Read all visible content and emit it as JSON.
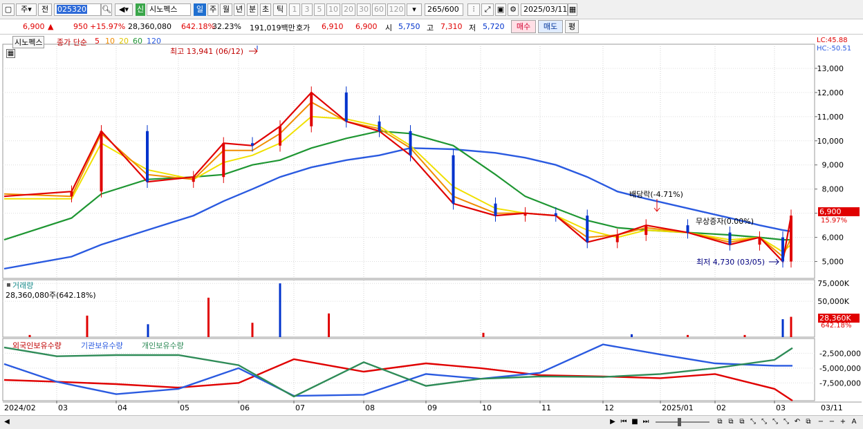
{
  "toolbar": {
    "jong_label": "주",
    "jeon_label": "전",
    "code_value": "025320",
    "name_badge": "신",
    "stock_name": "시노펙스",
    "period_tabs": [
      "일",
      "주",
      "월",
      "년",
      "분",
      "초",
      "틱"
    ],
    "interval_buttons": [
      "1",
      "3",
      "5",
      "10",
      "20",
      "30",
      "60",
      "120"
    ],
    "count_value": "265",
    "count_total": "/600",
    "date_value": "2025/03/11"
  },
  "quote": {
    "price": "6,900",
    "change": "950",
    "change_pct": "+15.97%",
    "volume": "28,360,080",
    "volume_ratio": "642.18%",
    "turnover_pct": "32.23%",
    "amount": "191,019백만",
    "hoga_label": "호가",
    "ask": "6,910",
    "bid": "6,900",
    "open_label": "시",
    "open": "5,750",
    "high_label": "고",
    "high": "7,310",
    "low_label": "저",
    "low": "5,720",
    "buy_label": "매수",
    "sell_label": "매도",
    "eval_label": "평"
  },
  "price_panel": {
    "title": "시노펙스",
    "legend_prefix": "종가 단순",
    "ma_labels": [
      "5",
      "10",
      "20",
      "60",
      "120"
    ],
    "lc_text": "LC:45.88",
    "hc_text": "HC:-50.51",
    "high_annotation": "최고 13,941 (06/12)",
    "low_annotation": "최저 4,730 (03/05)",
    "dividend_annotation": "배당락(-4.71%)",
    "bonus_annotation": "무상증자(0.00%)",
    "current_price_tag": "6,900",
    "current_pct_tag": "15.97%"
  },
  "volume_panel": {
    "title": "거래량",
    "value_text": "28,360,080주(642.18%)",
    "current_tag": "28,360K",
    "current_pct": "642.18%"
  },
  "holding_panel": {
    "series_labels": [
      "외국인보유수량",
      "기관보유수량",
      "개인보유수량"
    ]
  },
  "colors": {
    "up": "#e00000",
    "down": "#0033cc",
    "ma5": "#e00000",
    "ma10": "#f08c00",
    "ma20": "#f0e000",
    "ma60": "#1e9632",
    "ma120": "#2a5ae0",
    "foreign": "#e00000",
    "institution": "#2a5ae0",
    "individual": "#2e8b57"
  },
  "chart_data": [
    {
      "type": "line",
      "panel": "price",
      "title": "시노펙스",
      "x_ticks": [
        "2024/02",
        "03",
        "04",
        "05",
        "06",
        "07",
        "08",
        "09",
        "10",
        "11",
        "12",
        "2025/01",
        "02",
        "03",
        "03/11"
      ],
      "y_ticks": [
        5000,
        6000,
        7000,
        8000,
        9000,
        10000,
        11000,
        12000,
        13000
      ],
      "ylim": [
        4300,
        14000
      ],
      "x": [
        "2024-02",
        "2024-03",
        "2024-03",
        "2024-04",
        "2024-05",
        "2024-05",
        "2024-06",
        "2024-06",
        "2024-07",
        "2024-07",
        "2024-08",
        "2024-08",
        "2024-09",
        "2024-10",
        "2024-10",
        "2024-11",
        "2024-11",
        "2024-12",
        "2024-12",
        "2025-01",
        "2025-02",
        "2025-02",
        "2025-03",
        "2025-03-11"
      ],
      "series": [
        {
          "name": "5",
          "values": [
            7700,
            7900,
            10400,
            8300,
            8500,
            9900,
            9800,
            10600,
            12000,
            10800,
            10400,
            9400,
            7400,
            6900,
            7000,
            6900,
            5800,
            6100,
            6500,
            6200,
            5700,
            6000,
            5000,
            6900
          ]
        },
        {
          "name": "10",
          "values": [
            7800,
            7700,
            10300,
            8600,
            8400,
            9600,
            9600,
            10300,
            11600,
            10800,
            10500,
            9700,
            7700,
            7000,
            7000,
            6900,
            6000,
            6100,
            6400,
            6200,
            5800,
            6000,
            5200,
            6000
          ]
        },
        {
          "name": "20",
          "values": [
            7600,
            7600,
            9900,
            8800,
            8400,
            9100,
            9400,
            9900,
            11000,
            10900,
            10600,
            9800,
            8100,
            7200,
            7000,
            6900,
            6300,
            6000,
            6300,
            6200,
            5900,
            6000,
            5400,
            5700
          ]
        },
        {
          "name": "60",
          "values": [
            5900,
            6800,
            7800,
            8400,
            8500,
            8600,
            9000,
            9200,
            9700,
            10100,
            10400,
            10300,
            9800,
            8600,
            7700,
            7200,
            6700,
            6400,
            6300,
            6200,
            6100,
            6000,
            5900,
            5900
          ]
        },
        {
          "name": "120",
          "values": [
            4700,
            5200,
            5700,
            6300,
            6900,
            7500,
            8000,
            8500,
            8900,
            9200,
            9400,
            9700,
            9650,
            9500,
            9300,
            9000,
            8500,
            7900,
            7600,
            7200,
            6800,
            6500,
            6300,
            6250
          ]
        }
      ]
    },
    {
      "type": "bar",
      "panel": "volume",
      "title": "거래량",
      "y_ticks": [
        "75,000K",
        "50,000K"
      ],
      "ylim": [
        0,
        80000
      ],
      "x": [
        "2024-02",
        "2024-03",
        "2024-03",
        "2024-05",
        "2024-06",
        "2024-06",
        "2024-07",
        "2024-08",
        "2024-12",
        "2025-01",
        "2025-02",
        "2025-03",
        "2025-03-11"
      ],
      "values": [
        3000,
        30000,
        18000,
        55000,
        20000,
        75000,
        33000,
        6000,
        4000,
        3000,
        3000,
        25000,
        28360
      ]
    },
    {
      "type": "line",
      "panel": "holding",
      "y_ticks": [
        "-2,500,000",
        "-5,000,000",
        "-7,500,000"
      ],
      "ylim": [
        -10500000,
        0
      ],
      "x": [
        "2024-02",
        "2024-03",
        "2024-04",
        "2024-05",
        "2024-06",
        "2024-07",
        "2024-08",
        "2024-09",
        "2024-10",
        "2024-11",
        "2024-12",
        "2025-01",
        "2025-02",
        "2025-03",
        "2025-03-11"
      ],
      "series": [
        {
          "name": "외국인보유수량",
          "values": [
            -7000000,
            -7300000,
            -7700000,
            -8300000,
            -7500000,
            -3500000,
            -5600000,
            -4200000,
            -5000000,
            -6200000,
            -6400000,
            -6700000,
            -6000000,
            -8500000,
            -10500000
          ]
        },
        {
          "name": "기관보유수량",
          "values": [
            -4300000,
            -7300000,
            -9400000,
            -8500000,
            -5000000,
            -9700000,
            -9500000,
            -6000000,
            -6800000,
            -5800000,
            -1000000,
            -2700000,
            -4200000,
            -4600000,
            -4600000
          ]
        },
        {
          "name": "개인보유수량",
          "values": [
            -1500000,
            -3000000,
            -2800000,
            -2800000,
            -4500000,
            -9800000,
            -4000000,
            -8000000,
            -6800000,
            -6400000,
            -6500000,
            -6000000,
            -5000000,
            -3600000,
            -1600000
          ]
        }
      ]
    }
  ]
}
